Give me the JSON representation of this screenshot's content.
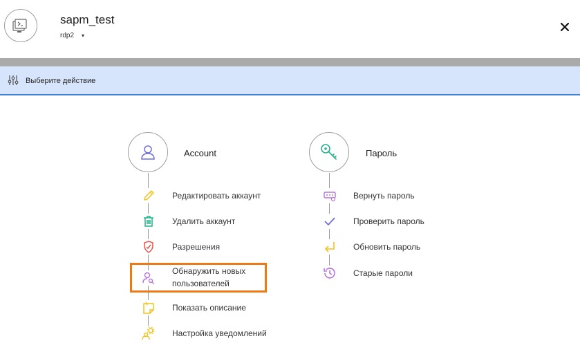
{
  "header": {
    "title": "sapm_test",
    "account": "rdp2",
    "app_icon": "terminal-stack-icon",
    "close_icon": "close-icon"
  },
  "action_bar": {
    "label": "Выберите действие",
    "icon": "sliders-icon"
  },
  "groups": {
    "account": {
      "title": "Account",
      "icon": "user-icon",
      "items": [
        {
          "label": "Редактировать аккаунт",
          "icon": "pencil-icon",
          "color": "#f2c31b"
        },
        {
          "label": "Удалить аккаунт",
          "icon": "trash-icon",
          "color": "#1fb58a"
        },
        {
          "label": "Разрешения",
          "icon": "shield-check-icon",
          "color": "#e9554d"
        },
        {
          "label": "Обнаружить новых пользователей",
          "label_line1": "Обнаружить новых",
          "label_line2": "пользователей",
          "icon": "user-search-icon",
          "color": "#b773e0",
          "highlighted": true
        },
        {
          "label": "Показать описание",
          "icon": "sticky-note-icon",
          "color": "#f2c31b"
        },
        {
          "label": "Настройка уведомлений",
          "icon": "user-gear-icon",
          "color": "#f2c31b"
        }
      ]
    },
    "password": {
      "title": "Пароль",
      "icon": "key-icon",
      "items": [
        {
          "label": "Вернуть пароль",
          "icon": "password-return-icon",
          "color": "#b773e0"
        },
        {
          "label": "Проверить пароль",
          "icon": "checkmark-icon",
          "color": "#6f6cdb"
        },
        {
          "label": "Обновить пароль",
          "icon": "enter-arrow-icon",
          "color": "#f2c31b"
        },
        {
          "label": "Старые пароли",
          "icon": "history-icon",
          "color": "#b773e0"
        }
      ]
    }
  },
  "colors": {
    "accent_blue": "#3f7fd9",
    "action_bar_bg": "#d6e5fb",
    "highlight_orange": "#ee7a15",
    "green": "#1fb58a",
    "purple": "#b773e0"
  }
}
